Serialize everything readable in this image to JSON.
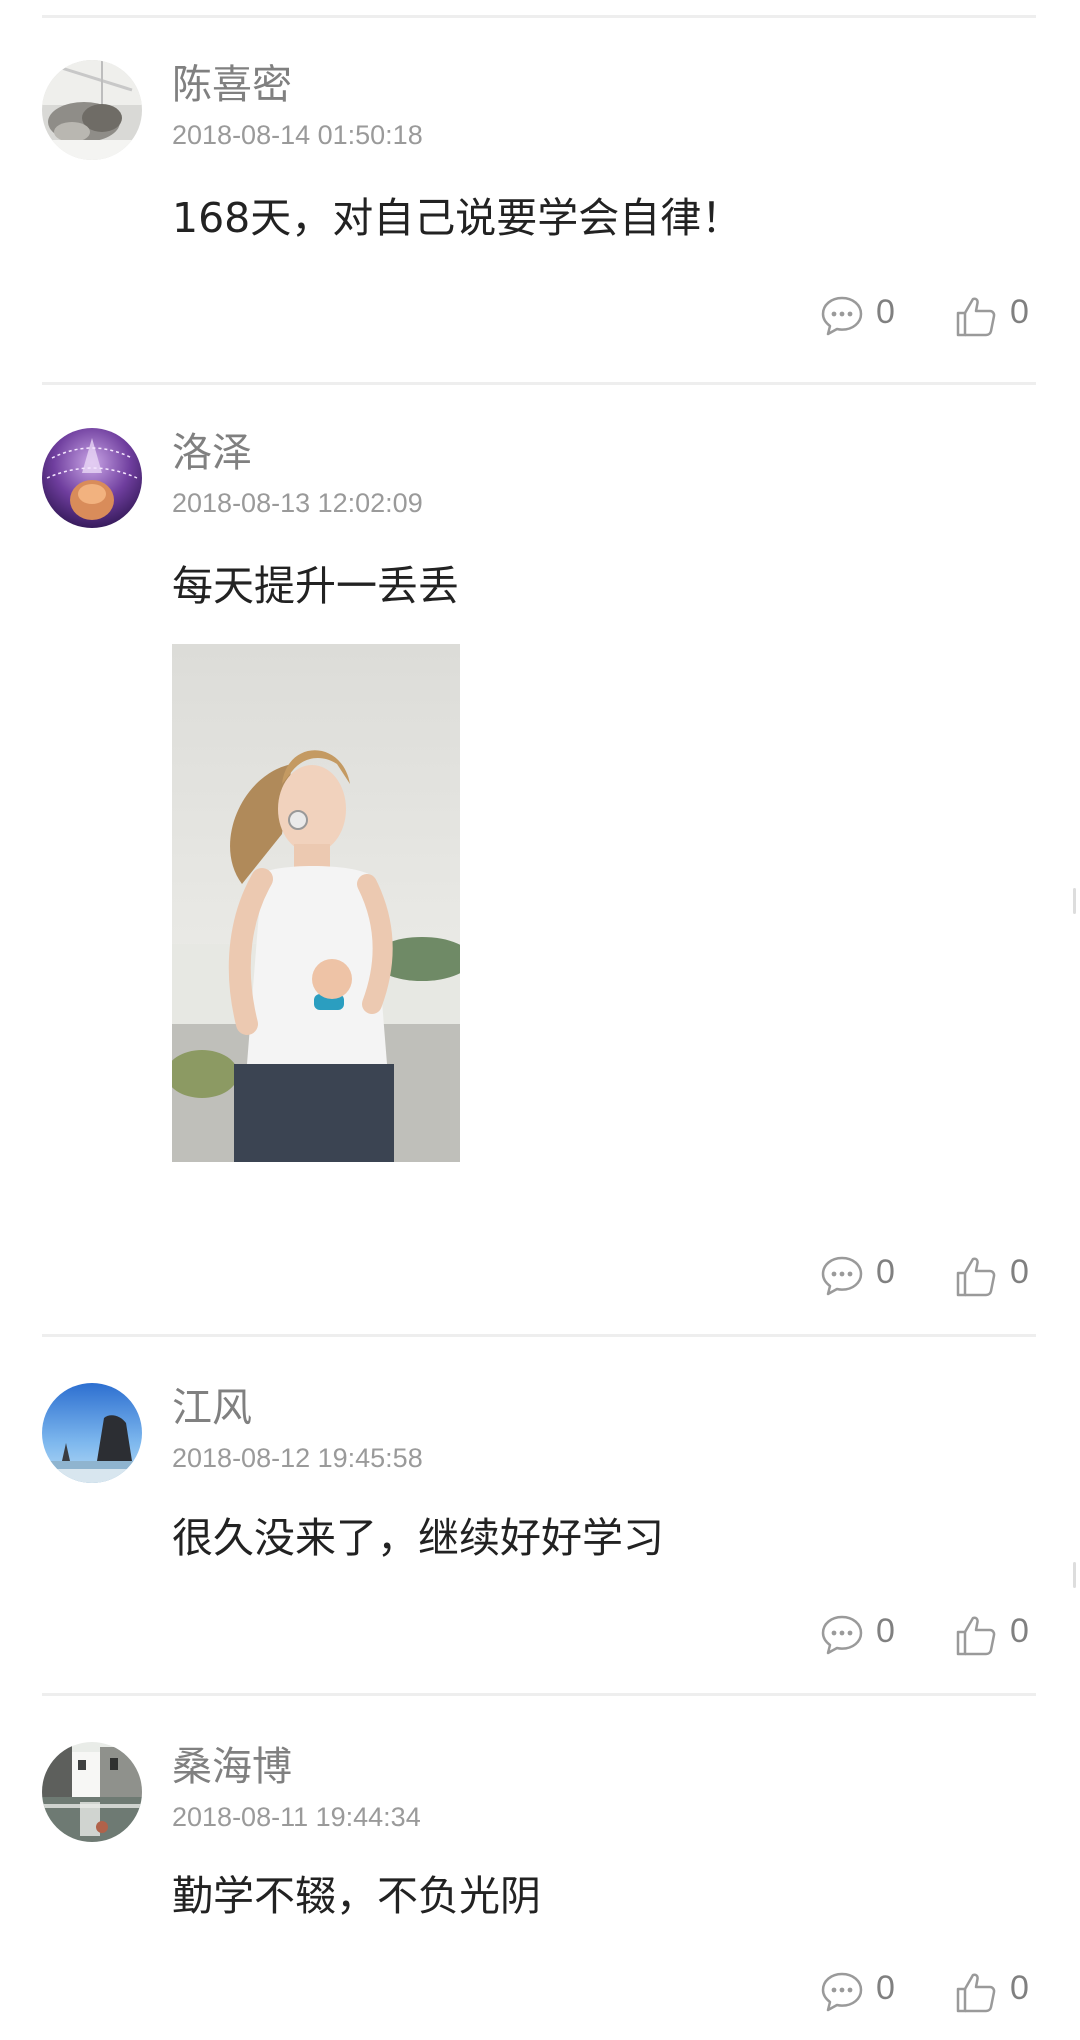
{
  "posts": [
    {
      "username": "陈喜密",
      "timestamp": "2018-08-14 01:50:18",
      "content": "168天，对自己说要学会自律！",
      "comments": "0",
      "likes": "0"
    },
    {
      "username": "洛泽",
      "timestamp": "2018-08-13 12:02:09",
      "content": "每天提升一丢丢",
      "comments": "0",
      "likes": "0"
    },
    {
      "username": "江风",
      "timestamp": "2018-08-12 19:45:58",
      "content": "很久没来了，继续好好学习",
      "comments": "0",
      "likes": "0"
    },
    {
      "username": "桑海博",
      "timestamp": "2018-08-11 19:44:34",
      "content": "勤学不辍，不负光阴",
      "comments": "0",
      "likes": "0"
    }
  ],
  "icons": {
    "comment": "comment-bubble-icon",
    "like": "thumbs-up-icon"
  },
  "colors": {
    "username": "#808080",
    "timestamp": "#9a9a9a",
    "content": "#222222",
    "divider": "#eeeeee",
    "icon": "#9a9a9a"
  }
}
